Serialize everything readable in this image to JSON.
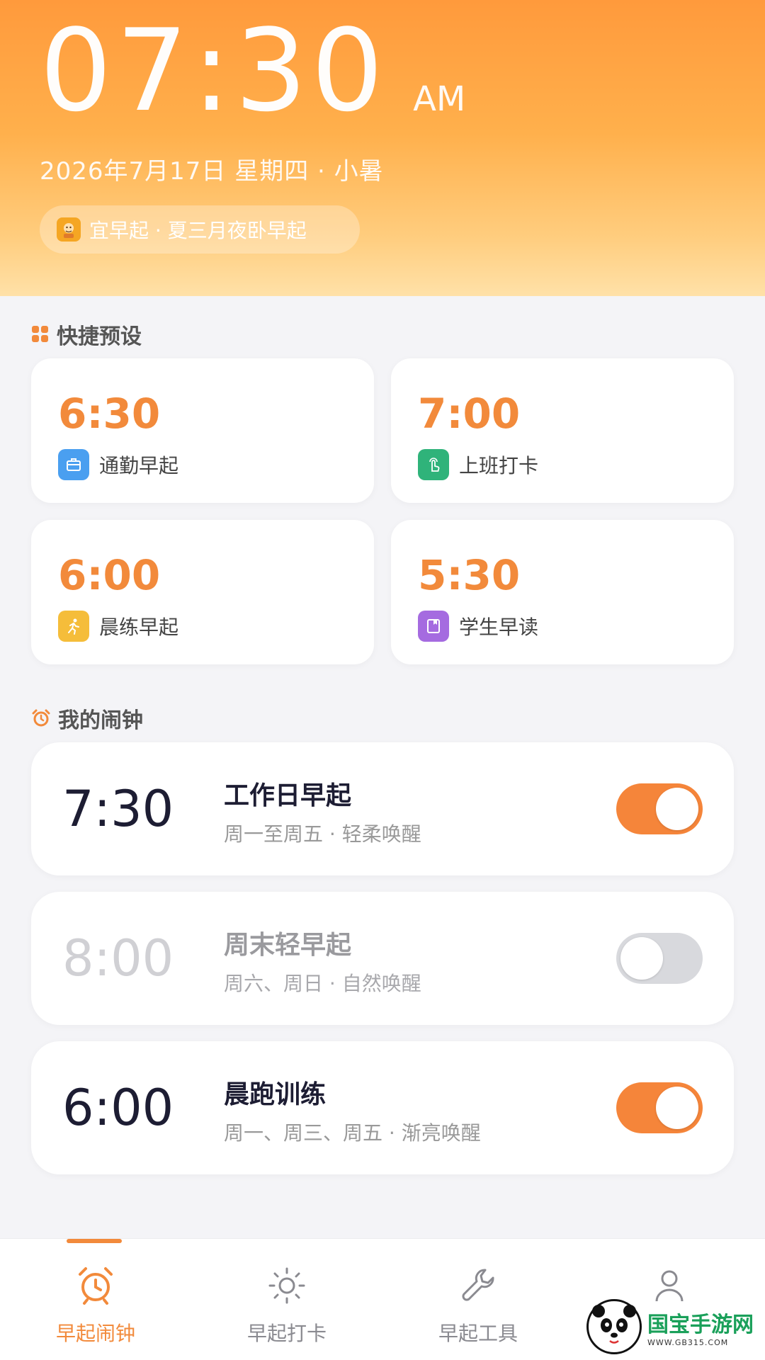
{
  "header": {
    "time": "07:30",
    "ampm": "AM",
    "date": "2026年7月17日 星期四 · 小暑",
    "tip": "宜早起 · 夏三月夜卧早起"
  },
  "presets": {
    "title": "快捷预设",
    "items": [
      {
        "time": "6:30",
        "label": "通勤早起",
        "icon": "briefcase-icon",
        "color": "#4a9ff0"
      },
      {
        "time": "7:00",
        "label": "上班打卡",
        "icon": "tap-icon",
        "color": "#2fb37a"
      },
      {
        "time": "6:00",
        "label": "晨练早起",
        "icon": "run-icon",
        "color": "#f5bd3a"
      },
      {
        "time": "5:30",
        "label": "学生早读",
        "icon": "book-icon",
        "color": "#a56be0"
      }
    ]
  },
  "alarms": {
    "title": "我的闹钟",
    "items": [
      {
        "time": "7:30",
        "name": "工作日早起",
        "desc": "周一至周五 · 轻柔唤醒",
        "enabled": true
      },
      {
        "time": "8:00",
        "name": "周末轻早起",
        "desc": "周六、周日 · 自然唤醒",
        "enabled": false
      },
      {
        "time": "6:00",
        "name": "晨跑训练",
        "desc": "周一、周三、周五 · 渐亮唤醒",
        "enabled": true
      }
    ]
  },
  "nav": {
    "items": [
      {
        "label": "早起闹钟",
        "icon": "alarm-clock-icon",
        "active": true
      },
      {
        "label": "早起打卡",
        "icon": "sun-icon",
        "active": false
      },
      {
        "label": "早起工具",
        "icon": "wrench-icon",
        "active": false
      },
      {
        "label": "",
        "icon": "user-icon",
        "active": false
      }
    ]
  },
  "watermark": {
    "title": "国宝手游网",
    "url": "WWW.GB315.COM"
  },
  "colors": {
    "accent": "#f28a3b",
    "header_top": "#ff9a3c",
    "header_bottom": "#ffe1a8"
  }
}
